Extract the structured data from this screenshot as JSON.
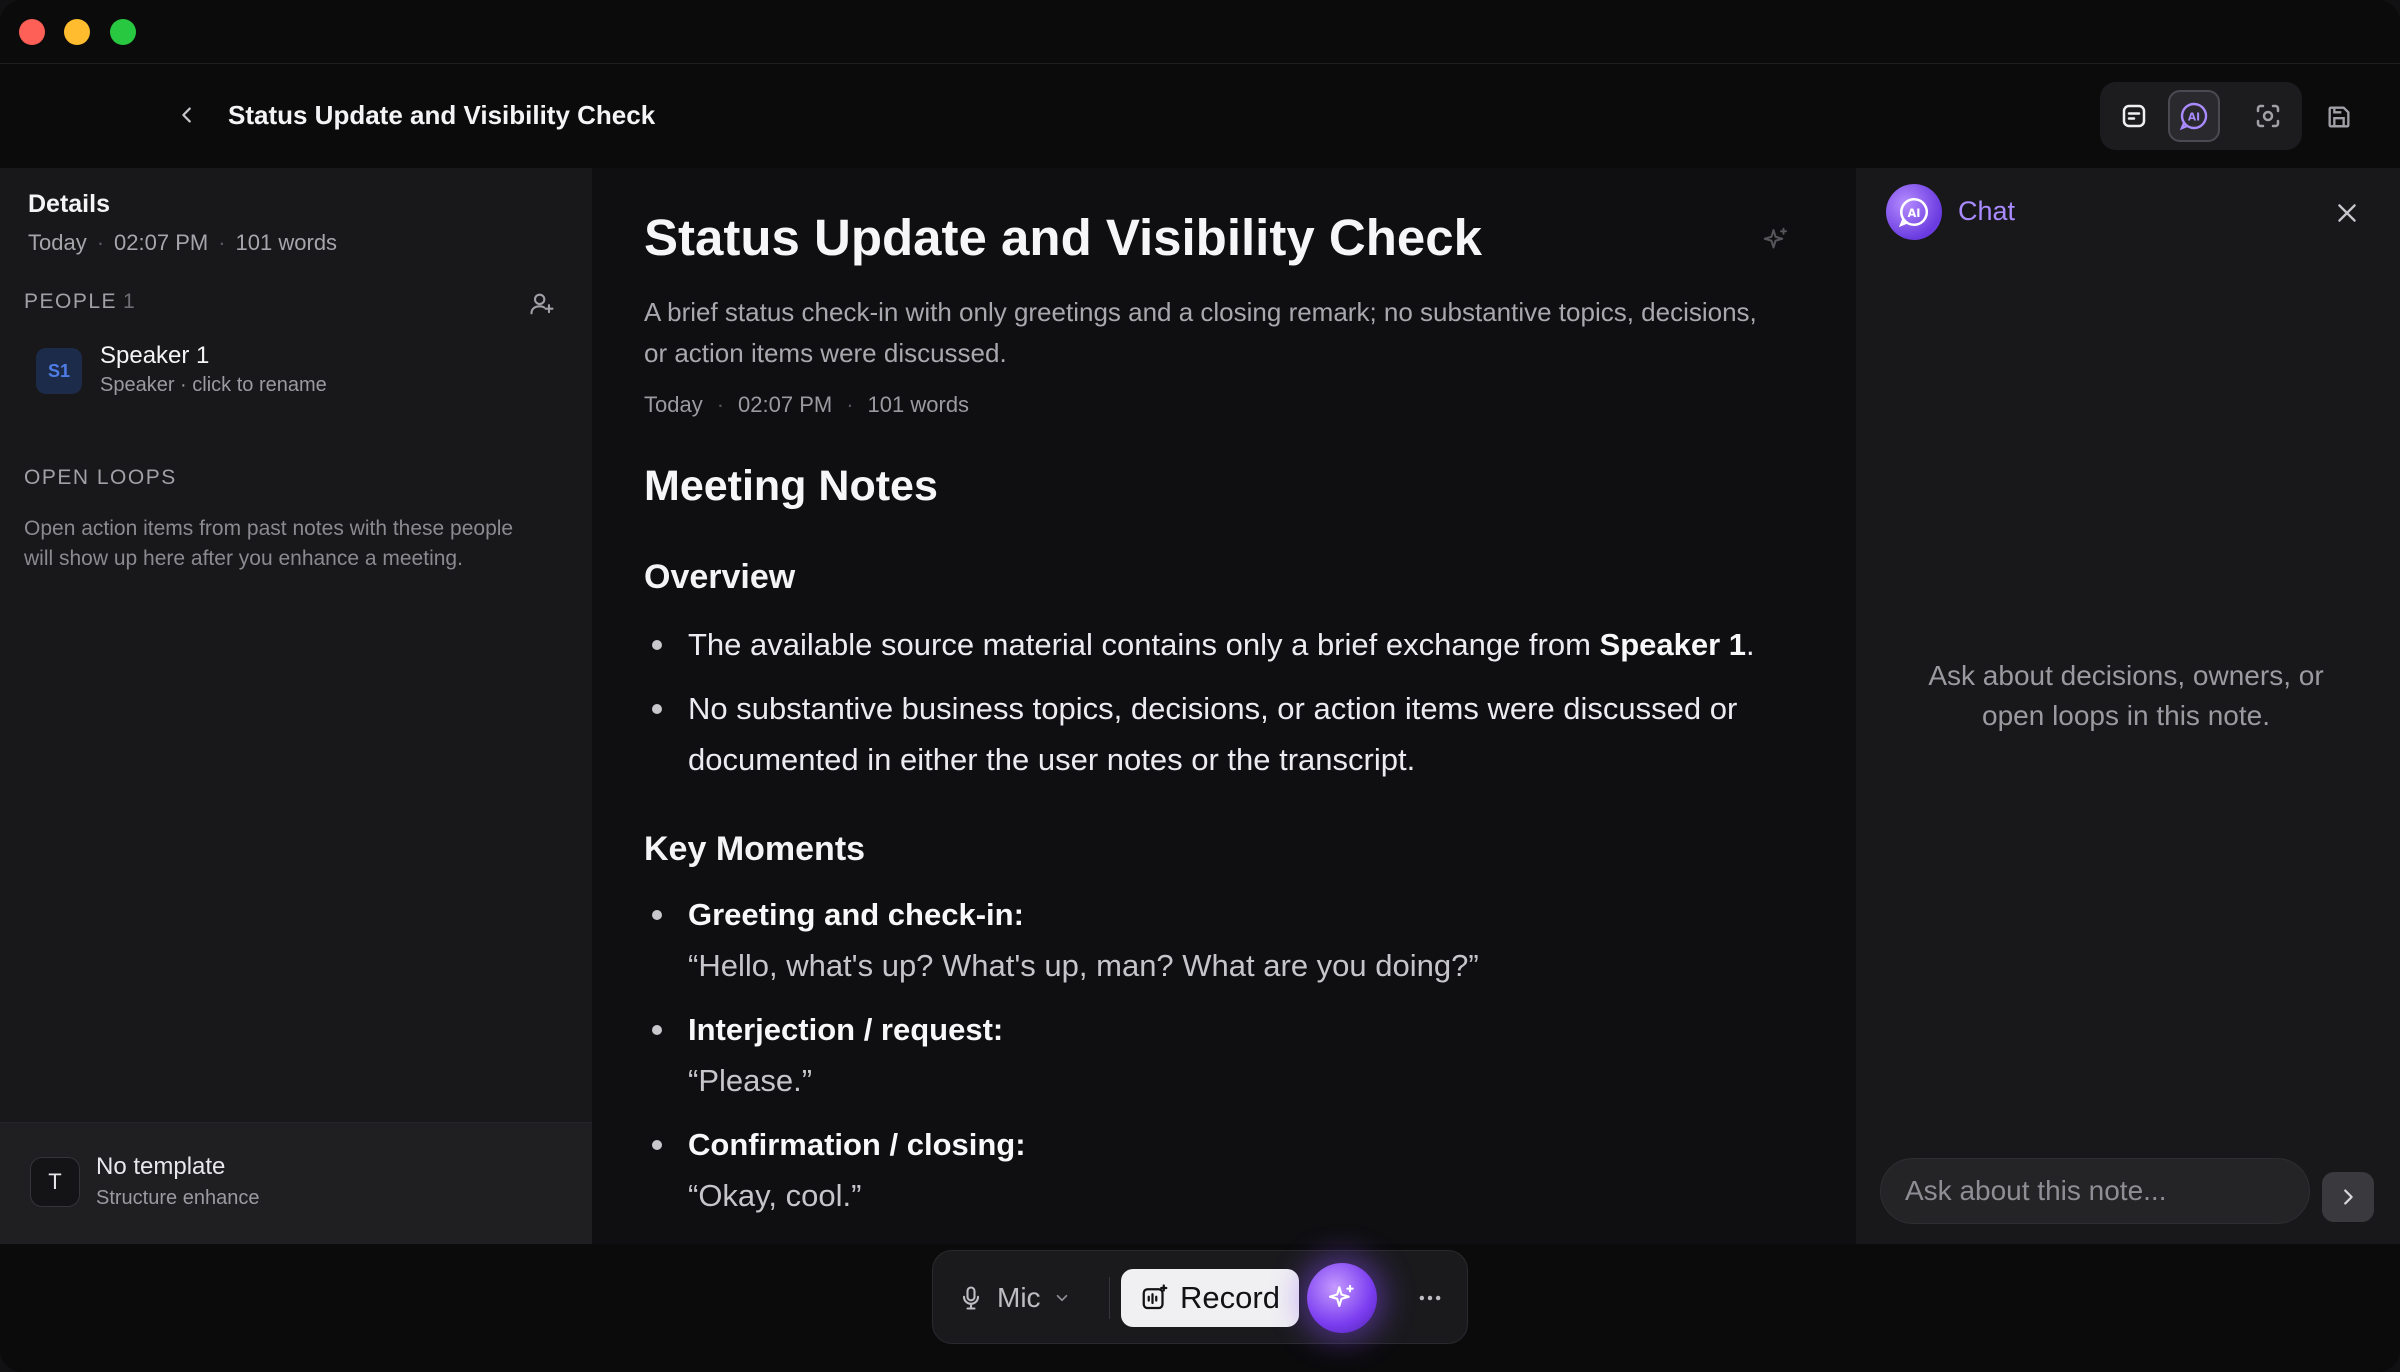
{
  "header": {
    "title": "Status Update and Visibility Check"
  },
  "sidebar": {
    "title": "Details",
    "meta": {
      "date": "Today",
      "time": "02:07 PM",
      "words": "101 words"
    },
    "people": {
      "heading": "PEOPLE",
      "count": "1",
      "speakers": [
        {
          "initials": "S1",
          "name": "Speaker 1",
          "subtitle": "Speaker · click to rename"
        }
      ]
    },
    "open_loops": {
      "heading": "OPEN LOOPS",
      "text": "Open action items from past notes with these people will show up here after you enhance a meeting."
    },
    "template": {
      "badge": "T",
      "name": "No template",
      "subtitle": "Structure enhance"
    }
  },
  "note": {
    "title": "Status Update and Visibility Check",
    "summary": "A brief status check-in with only greetings and a closing remark; no substantive topics, decisions, or action items were discussed.",
    "meta": {
      "date": "Today",
      "time": "02:07 PM",
      "words": "101 words"
    },
    "heading": "Meeting Notes",
    "overview": {
      "heading": "Overview",
      "b1_text": "The available source material contains only a brief exchange from ",
      "b1_bold": "Speaker 1",
      "b1_end": ".",
      "b2_text": "No substantive business topics, decisions, or action items were discussed or documented in either the user notes or the transcript."
    },
    "key_moments": {
      "heading": "Key Moments",
      "items": [
        {
          "label": "Greeting and check-in:",
          "quote": "“Hello, what's up? What's up, man? What are you doing?”"
        },
        {
          "label": "Interjection / request:",
          "quote": "“Please.”"
        },
        {
          "label": "Confirmation / closing:",
          "quote": "“Okay, cool.”"
        }
      ]
    }
  },
  "chat": {
    "title": "Chat",
    "empty_text": "Ask about decisions, owners, or open loops in this note.",
    "input_placeholder": "Ask about this note..."
  },
  "bottom_bar": {
    "mic_label": "Mic",
    "record_label": "Record"
  },
  "colors": {
    "accent_purple": "#a98bff",
    "speaker_blue": "#4f7de8",
    "traffic_red": "#fe5f57",
    "traffic_yellow": "#febc2e",
    "traffic_green": "#28c840"
  }
}
